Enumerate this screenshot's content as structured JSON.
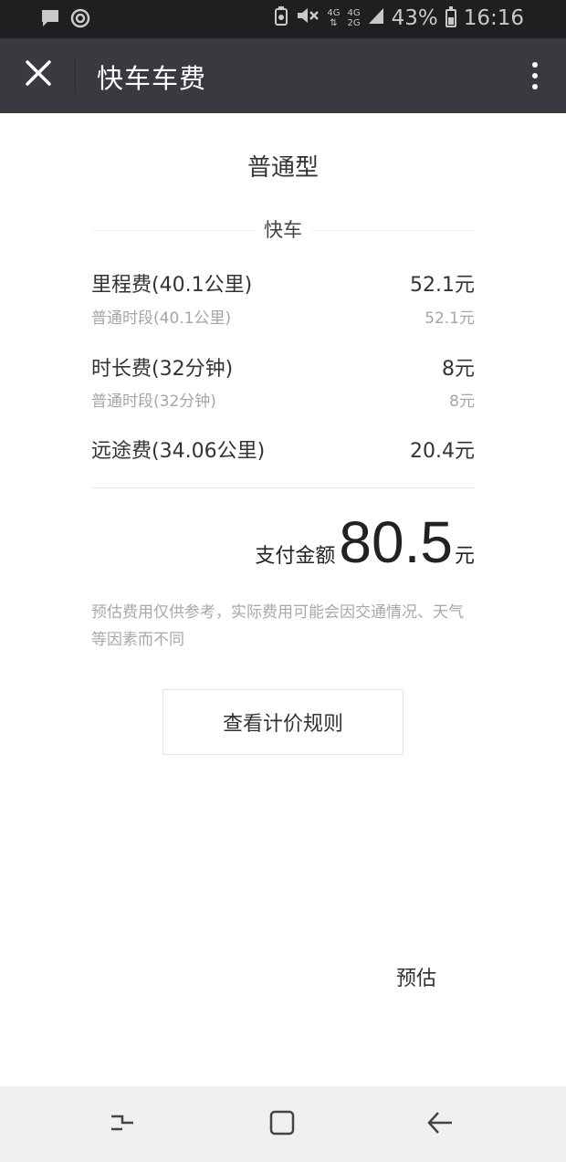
{
  "status_bar": {
    "network_top": "4G",
    "network_bottom": "2G",
    "battery": "43%",
    "time": "16:16"
  },
  "header": {
    "title": "快车车费",
    "close_icon": "close-icon",
    "more_icon": "more-vertical-icon"
  },
  "car_type": "普通型",
  "section_label": "快车",
  "fees": [
    {
      "label": "里程费(40.1公里)",
      "value": "52.1元",
      "sub_label": "普通时段(40.1公里)",
      "sub_value": "52.1元"
    },
    {
      "label": "时长费(32分钟)",
      "value": "8元",
      "sub_label": "普通时段(32分钟)",
      "sub_value": "8元"
    },
    {
      "label": "远途费(34.06公里)",
      "value": "20.4元"
    }
  ],
  "total": {
    "label": "支付金额",
    "amount": "80.5",
    "unit": "元"
  },
  "disclaimer": "预估费用仅供参考，实际费用可能会因交通情况、天气等因素而不同",
  "rule_button": "查看计价规则",
  "estimate_label": "预估",
  "nav": {
    "recent_icon": "recent-apps-icon",
    "home_icon": "home-icon",
    "back_icon": "back-icon"
  },
  "colors": {
    "status_bar_bg": "#1f1f20",
    "header_bg": "#393a3f",
    "nav_bg": "#f0f0f0"
  }
}
